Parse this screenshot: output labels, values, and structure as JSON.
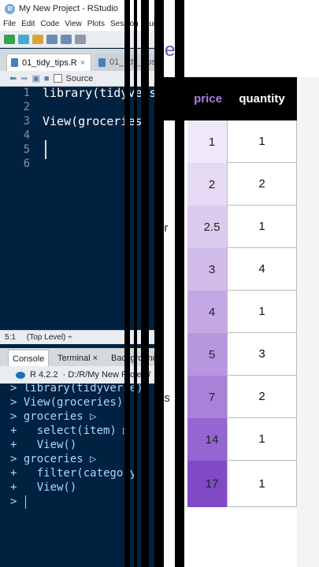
{
  "window": {
    "title": "My New Project - RStudio",
    "app_icon": "R"
  },
  "menu": [
    "File",
    "Edit",
    "Code",
    "View",
    "Plots",
    "Session",
    "Build"
  ],
  "editor": {
    "tabs": [
      {
        "label": "01_tidy_tips.R",
        "close": "×"
      },
      {
        "label": "01_tidy_tips"
      }
    ],
    "source_label": "Source",
    "lines": [
      {
        "num": "1",
        "code": "library(tidyverse)"
      },
      {
        "num": "2",
        "code": ""
      },
      {
        "num": "3",
        "code": "View(groceries)"
      },
      {
        "num": "4",
        "code": ""
      },
      {
        "num": "5",
        "code": ""
      },
      {
        "num": "6",
        "code": ""
      }
    ],
    "status_position": "5:1",
    "status_scope": "(Top Level) ÷"
  },
  "console": {
    "tabs": [
      "Console",
      "Terminal ×",
      "Background"
    ],
    "r_version": "R 4.2.2",
    "path": "· D:/R/My New Project/",
    "lines": [
      "> library(tidyverse)",
      "> View(groceries)",
      "> groceries ▷",
      "+   select(item) ▷",
      "+   View()",
      "> groceries ▷",
      "+   filter(category",
      "+   View()",
      ">"
    ]
  },
  "data_view": {
    "header_text": "ce)",
    "columns": [
      "price",
      "quantity"
    ],
    "rows": [
      {
        "price": "1",
        "quantity": "1",
        "fill": 0.12
      },
      {
        "price": "2",
        "quantity": "2",
        "fill": 0.2
      },
      {
        "price": "2.5",
        "quantity": "1",
        "fill": 0.27
      },
      {
        "price": "3",
        "quantity": "4",
        "fill": 0.35
      },
      {
        "price": "4",
        "quantity": "1",
        "fill": 0.45
      },
      {
        "price": "5",
        "quantity": "3",
        "fill": 0.55
      },
      {
        "price": "7",
        "quantity": "2",
        "fill": 0.66
      },
      {
        "price": "14",
        "quantity": "1",
        "fill": 0.8
      },
      {
        "price": "17",
        "quantity": "1",
        "fill": 0.95
      }
    ],
    "fragments": [
      "er",
      "r",
      "gs"
    ],
    "accent_color": "#7b3fc4"
  }
}
